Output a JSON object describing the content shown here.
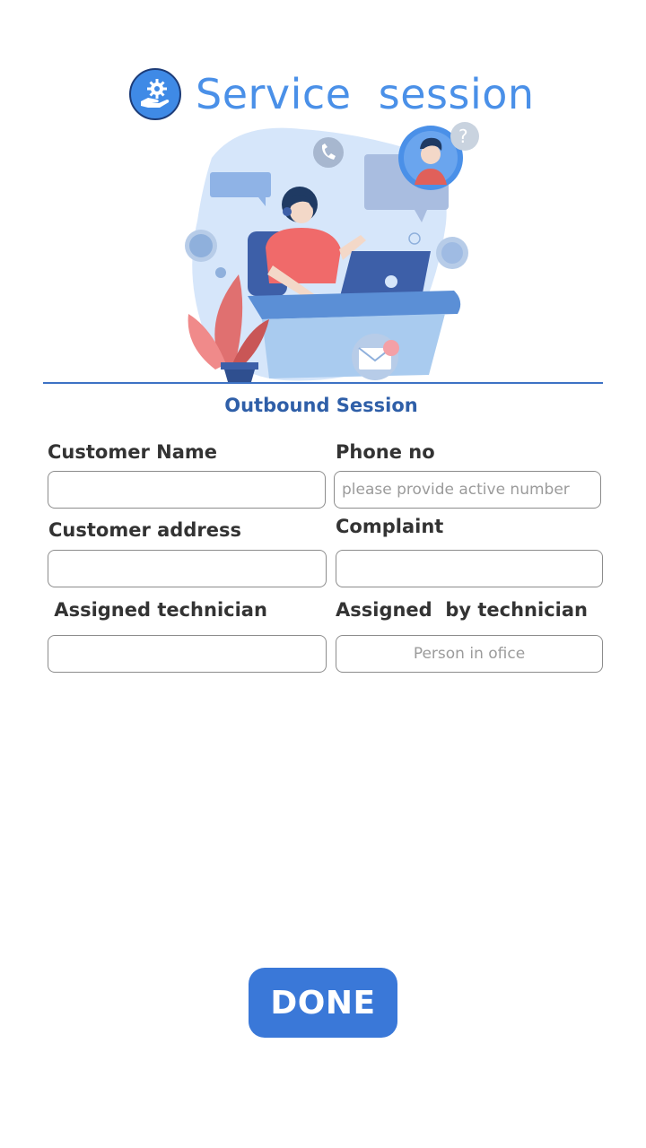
{
  "app": {
    "title": "Service  session",
    "logo_icon": "hand-gear-icon"
  },
  "colors": {
    "accent": "#4a90e8",
    "section": "#2f5fa8",
    "button": "#3a78d8"
  },
  "section_title": "Outbound Session",
  "form": {
    "customer_name_label": "Customer Name",
    "customer_name_value": "",
    "phone_label": "Phone no",
    "phone_placeholder": "please provide active number",
    "phone_value": "",
    "address_label": "Customer address",
    "address_value": "",
    "complaint_label": "Complaint",
    "complaint_value": "",
    "assigned_tech_label": " Assigned technician",
    "assigned_tech_value": "",
    "assigned_by_label": "Assigned  by technician",
    "assigned_by_placeholder": "Person in ofice",
    "assigned_by_value": ""
  },
  "done_label": "DONE"
}
